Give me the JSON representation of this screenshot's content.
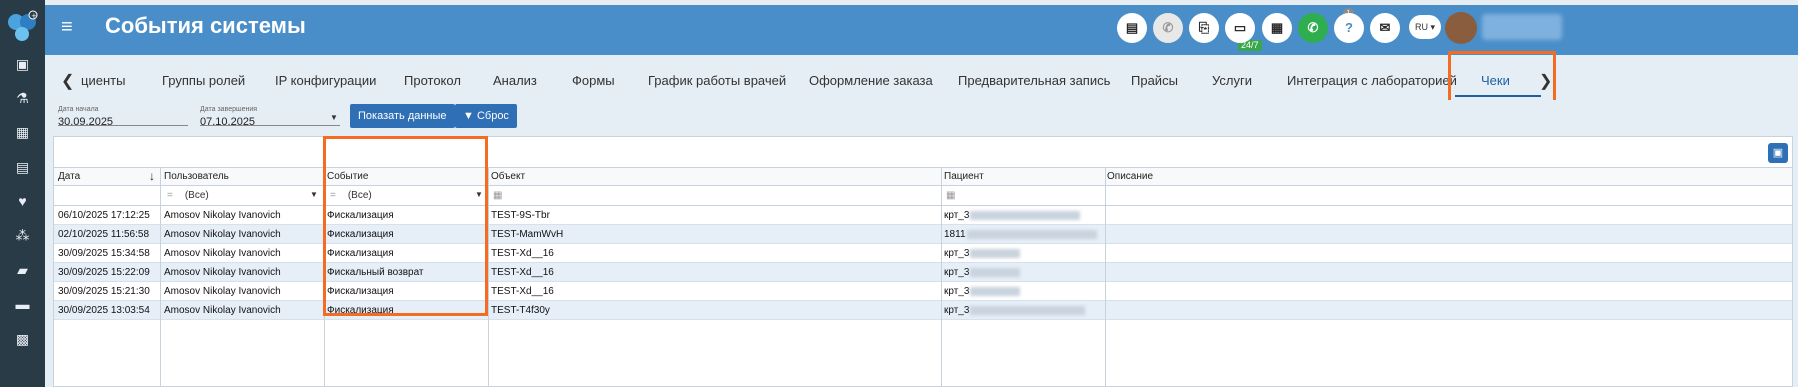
{
  "header": {
    "title": "События системы",
    "chat_badge": "24/7",
    "notif_count": "1",
    "lang": "RU"
  },
  "tabs": {
    "items": [
      {
        "label": "циенты"
      },
      {
        "label": "Группы ролей"
      },
      {
        "label": "IP конфигурации"
      },
      {
        "label": "Протокол"
      },
      {
        "label": "Анализ"
      },
      {
        "label": "Формы"
      },
      {
        "label": "График работы врачей"
      },
      {
        "label": "Оформление заказа"
      },
      {
        "label": "Предварительная запись"
      },
      {
        "label": "Прайсы"
      },
      {
        "label": "Услуги"
      },
      {
        "label": "Интеграция с лабораторией"
      },
      {
        "label": "Чеки"
      }
    ]
  },
  "filters": {
    "start_label": "Дата начала",
    "start_value": "30.09.2025",
    "end_label": "Дата завершения",
    "end_value": "07.10.2025",
    "show_button": "Показать данные",
    "reset_button": "Сброс"
  },
  "grid": {
    "columns": [
      "Дата",
      "Пользователь",
      "Событие",
      "Объект",
      "Пациент",
      "Описание"
    ],
    "user_filter": "(Все)",
    "event_filter": "(Все)",
    "rows": [
      {
        "date": "06/10/2025 17:12:25",
        "user": "Amosov Nikolay Ivanovich",
        "event": "Фискализация",
        "object": "TEST-9S-Tbr",
        "patient": "крт_3"
      },
      {
        "date": "02/10/2025 11:56:58",
        "user": "Amosov Nikolay Ivanovich",
        "event": "Фискализация",
        "object": "TEST-MamWvH",
        "patient": "1811"
      },
      {
        "date": "30/09/2025 15:34:58",
        "user": "Amosov Nikolay Ivanovich",
        "event": "Фискализация",
        "object": "TEST-Xd__16",
        "patient": "крт_3"
      },
      {
        "date": "30/09/2025 15:22:09",
        "user": "Amosov Nikolay Ivanovich",
        "event": "Фискальный возврат",
        "object": "TEST-Xd__16",
        "patient": "крт_3"
      },
      {
        "date": "30/09/2025 15:21:30",
        "user": "Amosov Nikolay Ivanovich",
        "event": "Фискализация",
        "object": "TEST-Xd__16",
        "patient": "крт_3"
      },
      {
        "date": "30/09/2025 13:03:54",
        "user": "Amosov Nikolay Ivanovich",
        "event": "Фискализация",
        "object": "TEST-T4f30y",
        "patient": "крт_3"
      }
    ]
  },
  "colors": {
    "header_bg": "#4a8ec9",
    "sidebar_bg": "#2a3b48",
    "accent": "#2f6fb5",
    "highlight": "#f36c21"
  }
}
